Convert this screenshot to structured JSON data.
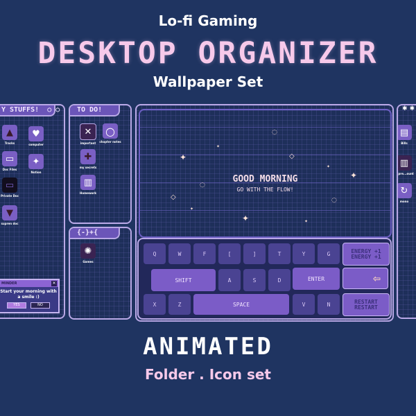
{
  "header": {
    "line1": "Lo-fi Gaming",
    "line2": "DESKTOP ORGANIZER",
    "line3": "Wallpaper Set"
  },
  "footer": {
    "line1": "ANIMATED",
    "line2": "Folder . Icon set"
  },
  "panels": {
    "stuff": {
      "title": "Y STUFFS!",
      "title_icons": "○ ○",
      "icons": [
        {
          "label": "Tracks",
          "glyph": "▲",
          "icon": "triangle-icon"
        },
        {
          "label": "computer",
          "glyph": "♥",
          "icon": "heart-icon"
        },
        {
          "label": "Doc Files",
          "glyph": "▭",
          "icon": "folder-icon"
        },
        {
          "label": "Notion",
          "glyph": "✦",
          "icon": "sparkle-icon"
        },
        {
          "label": "Private Doc",
          "glyph": "▭",
          "icon": "folder-dark-icon"
        },
        {
          "label": "supren doc",
          "glyph": "▼",
          "icon": "down-triangle-icon"
        }
      ]
    },
    "todo": {
      "title": "TO DO!",
      "icons": [
        {
          "label": "important",
          "glyph": "✕",
          "icon": "x-icon"
        },
        {
          "label": "chapter notes",
          "glyph": "○",
          "icon": "circle-icon"
        },
        {
          "label": "my secrets",
          "glyph": "✚",
          "icon": "plus-icon"
        },
        {
          "label": "Homework",
          "glyph": "▥",
          "icon": "book-icon"
        }
      ]
    },
    "games": {
      "title": "{-}+{",
      "icons": [
        {
          "label": "Games",
          "glyph": "✺",
          "icon": "sun-icon"
        }
      ]
    },
    "right": {
      "title": "✱ ✱",
      "icons": [
        {
          "label": "Bills",
          "glyph": "▤",
          "icon": "clipboard-icon"
        },
        {
          "label": "supre...ount",
          "glyph": "▥",
          "icon": "book-icon"
        },
        {
          "label": "mono",
          "glyph": "↻",
          "icon": "refresh-icon"
        }
      ]
    }
  },
  "screen": {
    "greeting": "GOOD MORNING",
    "subtitle": "GO WITH THE FLOW!"
  },
  "dialog": {
    "title": "MINDER",
    "message": "Start your morning with a smile :)",
    "yes": "YES",
    "no": "NO",
    "close": "✕"
  },
  "keyboard": {
    "row1": [
      "Q",
      "W",
      "F",
      "[",
      "]",
      "T",
      "Y",
      "G"
    ],
    "row2": [
      "SHIFT",
      "A",
      "S",
      "D",
      "ENTER"
    ],
    "row3": [
      "X",
      "Z",
      "SPACE",
      "V",
      "N"
    ],
    "side": {
      "energy": "ENERGY +1",
      "back_arrow": "⇦",
      "restart": "RESTART"
    }
  }
}
